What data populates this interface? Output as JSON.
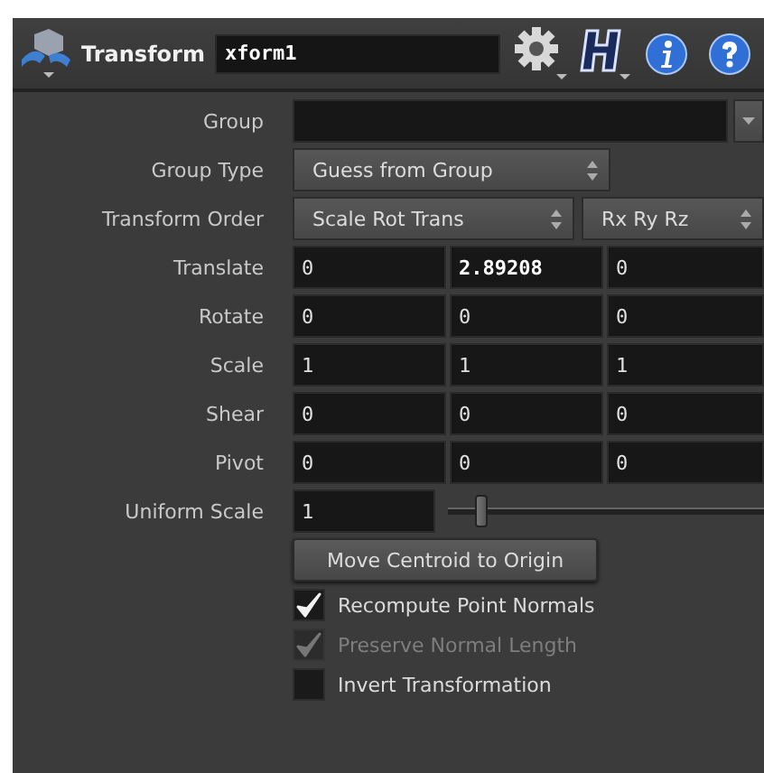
{
  "header": {
    "node_type": "Transform",
    "node_name": "xform1"
  },
  "parameters": [
    {
      "kind": "string_menu",
      "label": "Group"
    },
    {
      "kind": "menu",
      "label": "Group Type",
      "menus": [
        "Guess from Group"
      ]
    },
    {
      "kind": "menu",
      "label": "Transform Order",
      "menus": [
        "Scale Rot Trans",
        "Rx Ry Rz"
      ]
    },
    {
      "kind": "vector",
      "label": "Translate",
      "values": [
        {
          "text": "0",
          "modified": false
        },
        {
          "text": "2.89208",
          "modified": true
        },
        {
          "text": "0",
          "modified": false
        }
      ]
    },
    {
      "kind": "vector",
      "label": "Rotate",
      "values": [
        {
          "text": "0",
          "modified": false
        },
        {
          "text": "0",
          "modified": false
        },
        {
          "text": "0",
          "modified": false
        }
      ]
    },
    {
      "kind": "vector",
      "label": "Scale",
      "values": [
        {
          "text": "1",
          "modified": false
        },
        {
          "text": "1",
          "modified": false
        },
        {
          "text": "1",
          "modified": false
        }
      ]
    },
    {
      "kind": "vector",
      "label": "Shear",
      "values": [
        {
          "text": "0",
          "modified": false
        },
        {
          "text": "0",
          "modified": false
        },
        {
          "text": "0",
          "modified": false
        }
      ]
    },
    {
      "kind": "vector",
      "label": "Pivot",
      "values": [
        {
          "text": "0",
          "modified": false
        },
        {
          "text": "0",
          "modified": false
        },
        {
          "text": "0",
          "modified": false
        }
      ]
    },
    {
      "kind": "slider",
      "label": "Uniform Scale",
      "value": "1",
      "level": 0.1
    },
    {
      "kind": "button",
      "label": "Move Centroid to Origin"
    },
    {
      "kind": "toggle",
      "label": "Recompute Point Normals",
      "checked": true,
      "disabled": false
    },
    {
      "kind": "toggle",
      "label": "Preserve Normal Length",
      "checked": true,
      "disabled": true
    },
    {
      "kind": "toggle",
      "label": "Invert Transformation",
      "checked": false,
      "disabled": false
    }
  ]
}
